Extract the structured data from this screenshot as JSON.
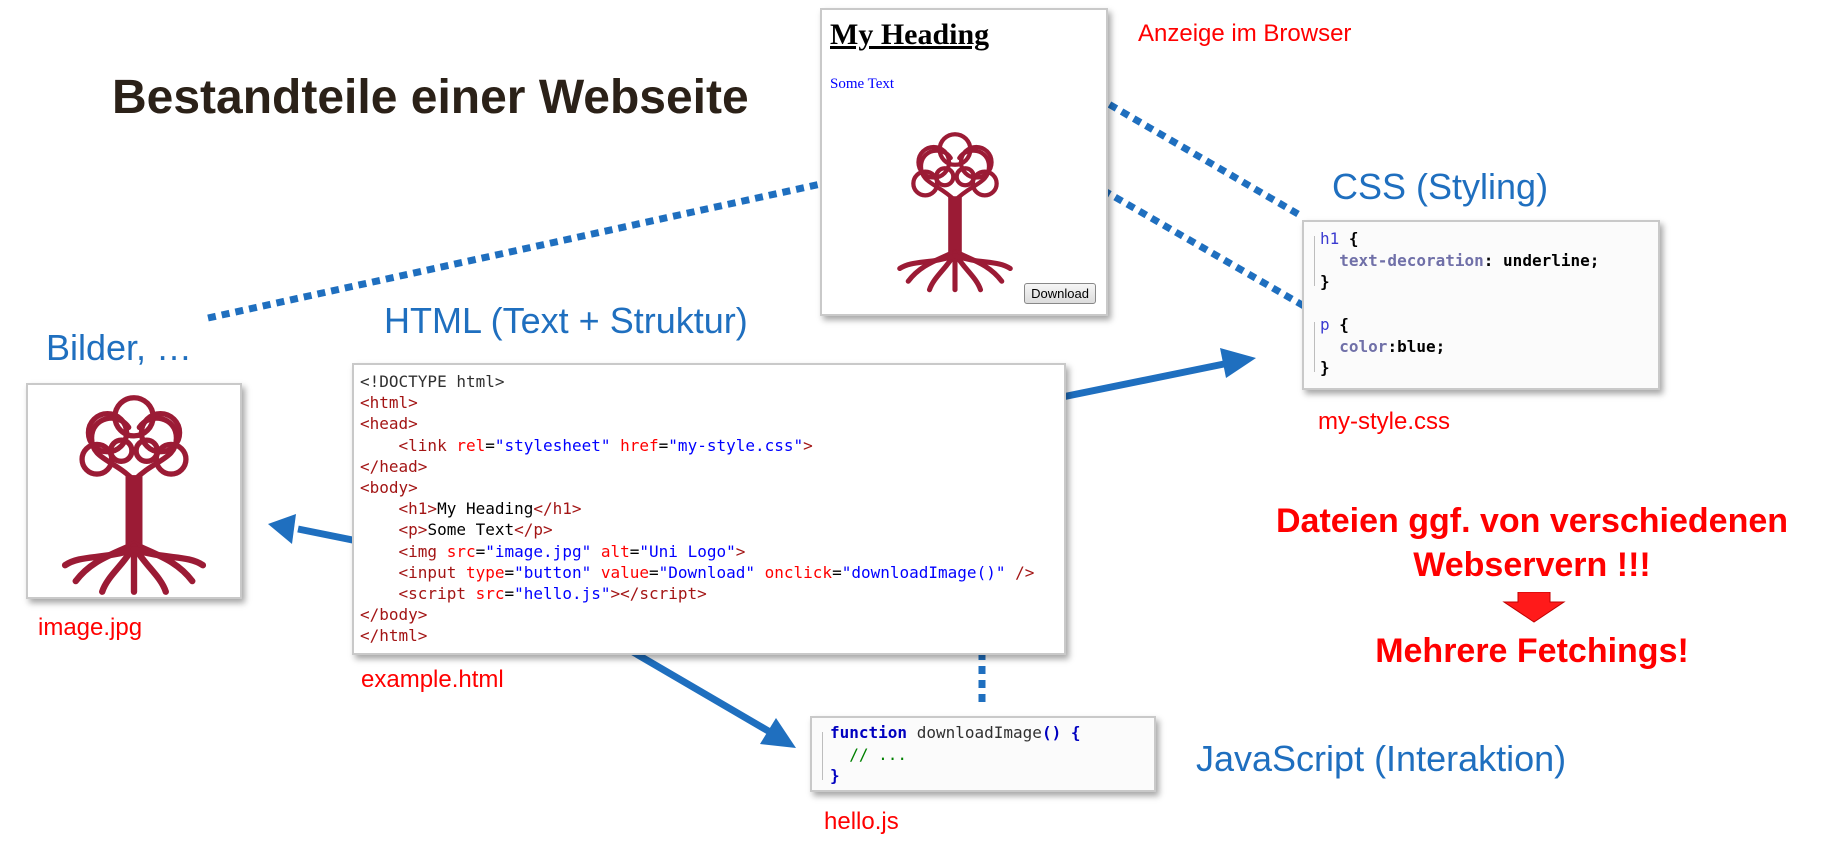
{
  "title": "Bestandteile einer Webseite",
  "labels": {
    "html_section": "HTML (Text + Struktur)",
    "css_section": "CSS (Styling)",
    "js_section": "JavaScript (Interaktion)",
    "images_section": "Bilder, …",
    "browser_caption": "Anzeige im Browser"
  },
  "files": {
    "html": "example.html",
    "css": "my-style.css",
    "js": "hello.js",
    "image": "image.jpg"
  },
  "browser": {
    "heading": "My Heading",
    "text": "Some Text",
    "button": "Download"
  },
  "note": {
    "line1": "Dateien ggf. von verschiedenen",
    "line2": "Webservern !!!",
    "line3": "Mehrere Fetchings!"
  },
  "html_code": {
    "doctype": "<!DOCTYPE html>",
    "attr_rel": "rel",
    "val_rel": "\"stylesheet\"",
    "attr_href": "href",
    "val_href": "\"my-style.css\"",
    "h1_text": "My Heading",
    "p_text": "Some Text",
    "attr_src": "src",
    "val_img_src": "\"image.jpg\"",
    "attr_alt": "alt",
    "val_alt": "\"Uni Logo\"",
    "attr_type": "type",
    "val_type": "\"button\"",
    "attr_value": "value",
    "val_value": "\"Download\"",
    "attr_onclick": "onclick",
    "val_onclick": "\"downloadImage()\"",
    "val_script_src": "\"hello.js\""
  },
  "css_code": {
    "sel1": "h1",
    "prop1": "text-decoration",
    "val1": "underline",
    "sel2": "p",
    "prop2": "color",
    "val2": "blue"
  },
  "js_code": {
    "keyword": "function",
    "fn_name": "downloadImage",
    "comment": "// ..."
  },
  "colors": {
    "arrow": "#1f6fbf",
    "label_blue": "#1f6fbf",
    "label_red": "#ff0000",
    "tree": "#9b1b35"
  }
}
